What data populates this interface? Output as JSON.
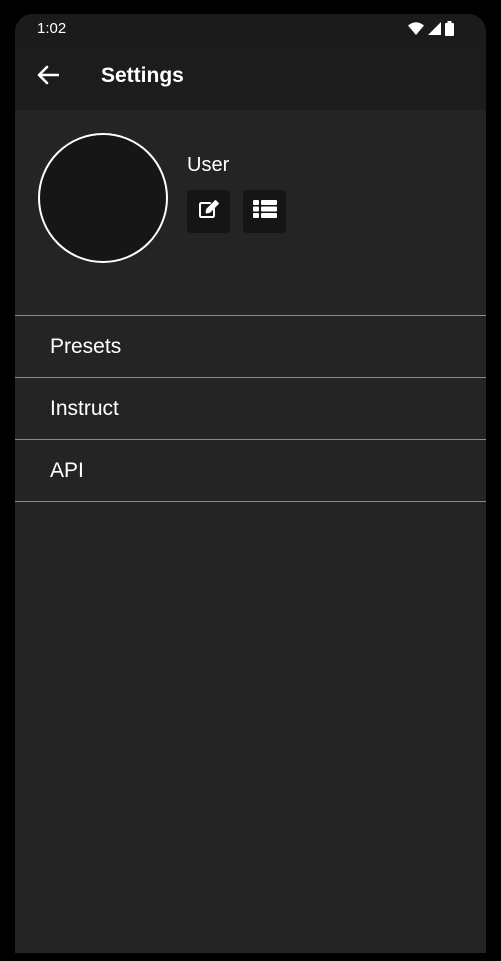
{
  "status_bar": {
    "time": "1:02",
    "icons": [
      "wifi-icon",
      "cellular-signal-icon",
      "battery-icon"
    ]
  },
  "app_bar": {
    "back_icon": "arrow-left-icon",
    "title": "Settings"
  },
  "profile": {
    "name": "User",
    "edit_icon": "edit-icon",
    "list_icon": "list-icon"
  },
  "menu": {
    "items": [
      {
        "label": "Presets"
      },
      {
        "label": "Instruct"
      },
      {
        "label": "API"
      }
    ]
  },
  "colors": {
    "background": "#242424",
    "app_bar": "#1c1c1c",
    "text": "#ffffff",
    "divider": "#8a8a8a",
    "button_bg": "#151515"
  }
}
